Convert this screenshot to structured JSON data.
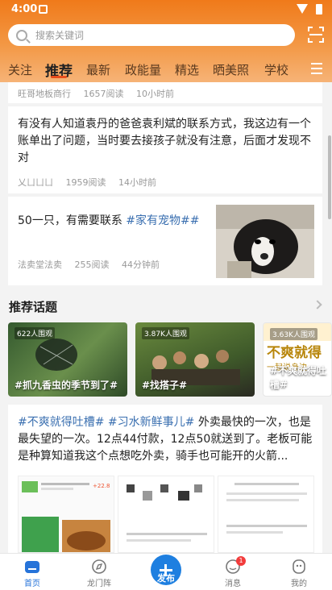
{
  "status_bar": {
    "time": "4:00"
  },
  "search": {
    "placeholder": "搜索关键词"
  },
  "tabs": [
    {
      "label": "关注"
    },
    {
      "label": "推荐"
    },
    {
      "label": "最新"
    },
    {
      "label": "政能量"
    },
    {
      "label": "精选"
    },
    {
      "label": "晒美照"
    },
    {
      "label": "学校"
    }
  ],
  "feed": [
    {
      "author": "旺哥地板商行",
      "reads": "1657阅读",
      "time": "10小时前"
    },
    {
      "text": "有没有人知道袁丹的爸爸袁利斌的联系方式，我这边有一个账单出了问题，当时要去接孩子就没有注意，后面才发现不对",
      "author": "乂ㄩㄩㄩ",
      "reads": "1959阅读",
      "time": "14小时前"
    },
    {
      "text": "50一只，有需要联系 ",
      "topic": "#家有宠物##",
      "author": "法卖堂法卖",
      "reads": "255阅读",
      "time": "44分钟前"
    }
  ],
  "recommended_topics": {
    "title": "推荐话题",
    "items": [
      {
        "views": "622人围观",
        "name": "#抓九香虫的季节到了#"
      },
      {
        "views": "3.87K人围观",
        "name": "#找搭子#"
      },
      {
        "views": "3.63K人围观",
        "name": "#不爽就得吐槽#",
        "overlay_title": "不爽就得",
        "overlay_sub": "一起说身边"
      }
    ]
  },
  "post": {
    "topics": "#不爽就得吐槽# #习水新鲜事儿#",
    "text": " 外卖最快的一次，也是最失望的一次。12点44付款，12点50就送到了。老板可能是种算知道我这个点想吃外卖，骑手也可能开的火箭..."
  },
  "bottom_nav": {
    "home": "首页",
    "longmen": "龙门阵",
    "publish": "发布",
    "messages": "消息",
    "messages_badge": "1",
    "mine": "我的"
  }
}
